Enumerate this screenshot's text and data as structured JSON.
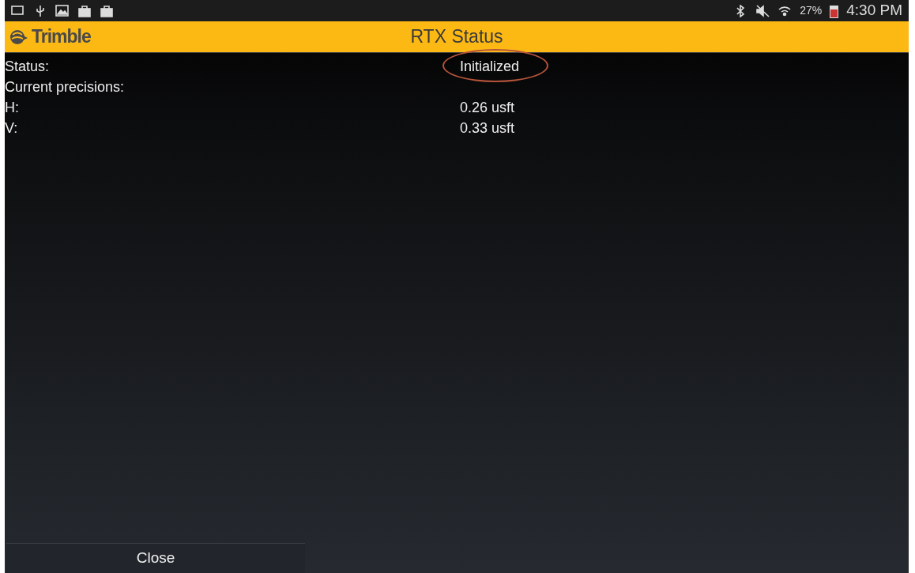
{
  "status_bar": {
    "battery": "27%",
    "time": "4:30 PM"
  },
  "header": {
    "logo": "Trimble",
    "title": "RTX Status"
  },
  "rows": [
    {
      "label": "Status:",
      "value": "Initialized",
      "circled": true
    },
    {
      "label": "Current precisions:"
    },
    {
      "label": "H:",
      "value": "0.26 usft"
    },
    {
      "label": "V:",
      "value": "0.33 usft"
    }
  ],
  "buttons": [
    {
      "label": "Close"
    }
  ]
}
